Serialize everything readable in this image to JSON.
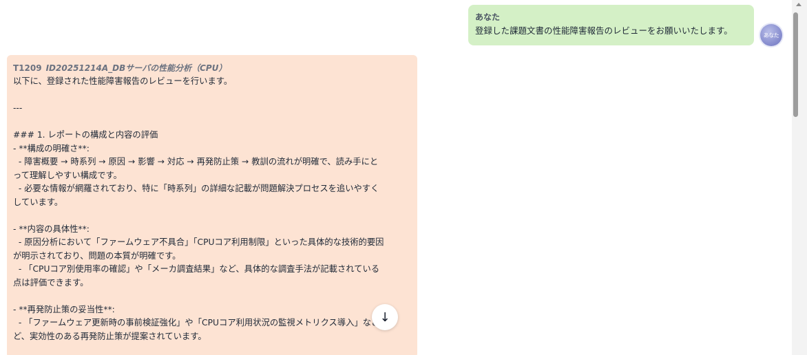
{
  "user_message": {
    "sender": "あなた",
    "text": "登録した課題文書の性能障害報告のレビューをお願いいたします。",
    "avatar_label": "あなた"
  },
  "assistant_message": {
    "ticket_id": "T1209",
    "document_title": "ID20251214A_DBサーバの性能分析（CPU）",
    "lines": [
      "以下に、登録された性能障害報告のレビューを行います。",
      "",
      "---",
      "",
      "### 1. レポートの構成と内容の評価",
      "- **構成の明確さ**:",
      "  - 障害概要 → 時系列 → 原因 → 影響 → 対応 → 再発防止策 → 教訓の流れが明確で、読み手にと",
      "って理解しやすい構成です。",
      "  - 必要な情報が網羅されており、特に「時系列」の詳細な記載が問題解決プロセスを追いやすく",
      "しています。",
      "",
      "- **内容の具体性**:",
      "  - 原因分析において「ファームウェア不具合」「CPUコア利用制限」といった具体的な技術的要因",
      "が明示されており、問題の本質が明確です。",
      "  - 「CPUコア別使用率の確認」や「メーカ調査結果」など、具体的な調査手法が記載されている",
      "点は評価できます。",
      "",
      "- **再発防止策の妥当性**:",
      "  - 「ファームウェア更新時の事前検証強化」や「CPUコア利用状況の監視メトリクス導入」など",
      "ど、実効性のある再発防止策が提案されています。"
    ]
  },
  "controls": {
    "scroll_down_icon": "↓"
  }
}
